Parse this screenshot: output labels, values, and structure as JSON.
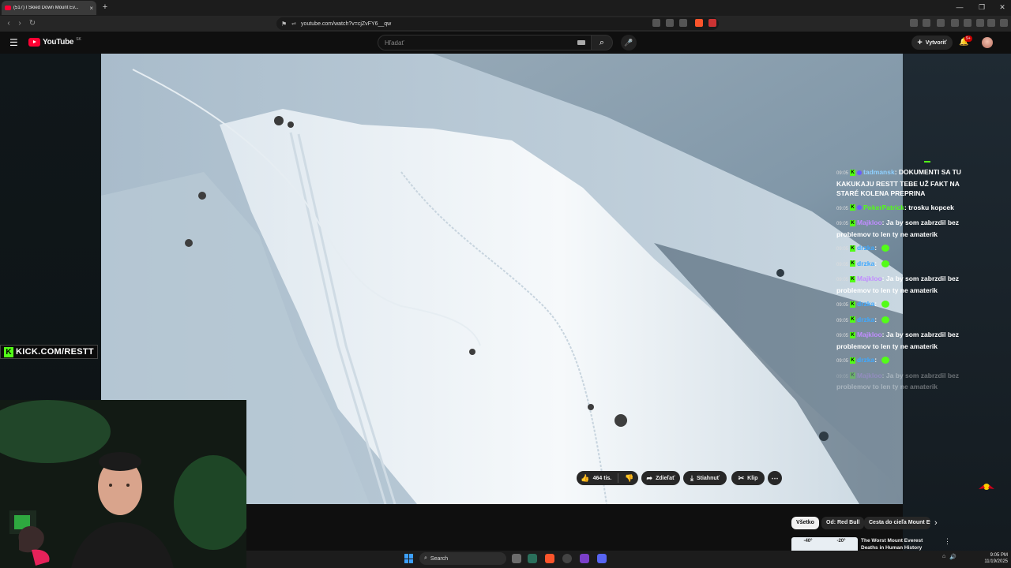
{
  "browser": {
    "tab_title": "(517) I Skied Down Mount Ev...",
    "tab_close": "×",
    "new_tab": "+",
    "url": "youtube.com/watch?v=cjZvFY6__qw",
    "window_controls": [
      "—",
      "❐",
      "✕"
    ]
  },
  "youtube": {
    "logo_text": "YouTube",
    "country_code": "SK",
    "search_placeholder": "Hľadať",
    "create_label": "Vytvoriť",
    "notification_count": "9+"
  },
  "stream": {
    "kick_label": "KICK.COM/RESTT",
    "chat": [
      {
        "time": "09:05",
        "user": "tadmansk",
        "text": "DOKUMENTI SA TU KAKUKAJU RESTT TEBE UŽ FAKT NA STARÉ KOLENA PREPRINA"
      },
      {
        "time": "09:05",
        "user": "PokerPatrick",
        "text": "trosku kopcek"
      },
      {
        "time": "09:05",
        "user": "Majkloo",
        "text": "Ja by som zabrzdil bez problemov to len ty ne amaterik"
      },
      {
        "time": "09:05",
        "user": "drzka",
        "text": ""
      },
      {
        "time": "09:05",
        "user": "drzka",
        "text": ""
      },
      {
        "time": "09:05",
        "user": "Majkloo",
        "text": "Ja by som zabrzdil bez problemov to len ty ne amaterik"
      },
      {
        "time": "09:05",
        "user": "drzka",
        "text": ""
      },
      {
        "time": "09:05",
        "user": "drzka",
        "text": ""
      },
      {
        "time": "09:05",
        "user": "Majkloo",
        "text": "Ja by som zabrzdil bez problemov to len ty ne amaterik"
      },
      {
        "time": "09:05",
        "user": "drzka",
        "text": ""
      },
      {
        "time": "09:05",
        "user": "Majkloo",
        "text": "Ja by som zabrzdil bez problemov to len ty ne amaterik"
      }
    ]
  },
  "actions": {
    "likes": "464 tis.",
    "share": "Zdieľať",
    "download": "Stiahnuť",
    "clip": "Klip"
  },
  "chips": [
    "Všetko",
    "Od: Red Bull",
    "Cesta do cieľa Mount Ev"
  ],
  "recommended": {
    "title": "The Worst Mount Everest Deaths in Human History",
    "temp_a": "-40°",
    "temp_b": "-20°"
  },
  "taskbar": {
    "search": "Search",
    "time": "9:05 PM",
    "date": "11/19/2025"
  },
  "colors": {
    "kick_green": "#53fc18",
    "youtube_red": "#ff0033",
    "chat_purple": "#c18cff",
    "chat_blue": "#3fa9ff"
  }
}
